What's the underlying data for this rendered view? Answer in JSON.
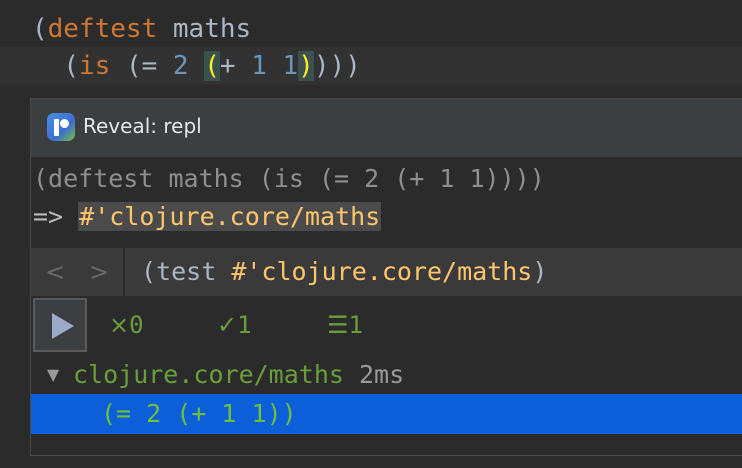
{
  "editor": {
    "line1": {
      "open": "(",
      "keyword": "deftest",
      "name": " maths"
    },
    "line2": {
      "indent": "  ",
      "p1": "(",
      "is": "is",
      "sp1": " ",
      "p2": "(",
      "eq": "= ",
      "two": "2",
      "sp2": " ",
      "p3": "(",
      "plus": "+ ",
      "one_a": "1",
      "sp3": " ",
      "one_b": "1",
      "p3_close": ")",
      "closing": ")))"
    }
  },
  "popup": {
    "title": "Reveal: repl",
    "input_echo": "(deftest maths (is (= 2 (+ 1 1))))",
    "result_arrow": "=> ",
    "result_value": "#'clojure.core/maths",
    "nav": {
      "back_label": "<",
      "forward_label": ">",
      "title_prefix": "(test ",
      "title_value": "#'clojure.core/maths",
      "title_suffix": ")"
    },
    "test_stats": {
      "fail_icon": "×",
      "fail_count": "0",
      "pass_icon": "✓",
      "pass_count": "1",
      "total_icon": "☰",
      "total_count": "1"
    },
    "tree": {
      "toggle_icon": "▼",
      "namespace": "clojure.core/maths",
      "time": " 2ms",
      "assertion": "(= 2 (+ 1 1))"
    }
  },
  "colors": {
    "background": "#2b2b2b",
    "keyword": "#cc7832",
    "number": "#6897bb",
    "value": "#ffc66d",
    "pass_green": "#6a9e3c",
    "selection": "#0d5fd9"
  }
}
